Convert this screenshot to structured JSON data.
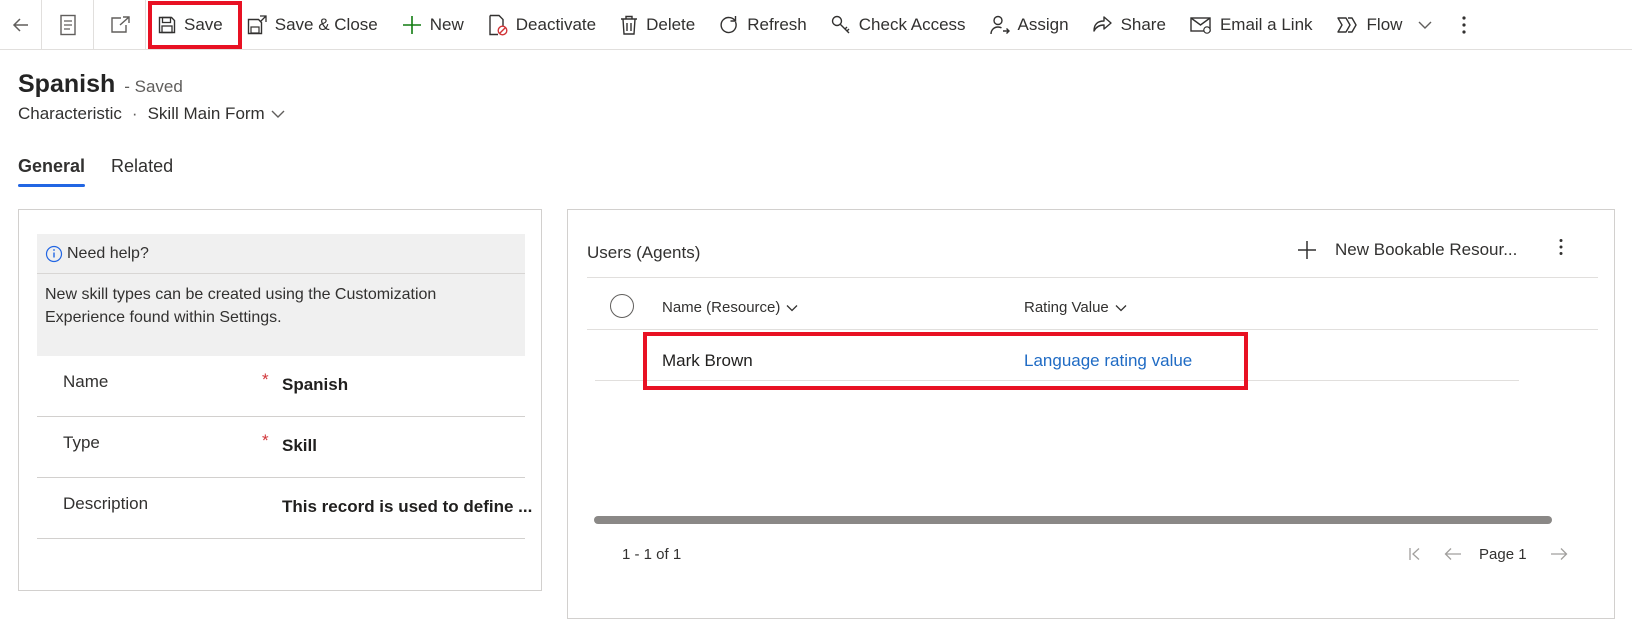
{
  "toolbar": {
    "save": "Save",
    "save_close": "Save & Close",
    "new": "New",
    "deactivate": "Deactivate",
    "delete": "Delete",
    "refresh": "Refresh",
    "check_access": "Check Access",
    "assign": "Assign",
    "share": "Share",
    "email_link": "Email a Link",
    "flow": "Flow"
  },
  "record": {
    "title": "Spanish",
    "status": "- Saved",
    "entity": "Characteristic",
    "separator": "·",
    "form": "Skill Main Form"
  },
  "tabs": [
    {
      "label": "General",
      "active": true
    },
    {
      "label": "Related",
      "active": false
    }
  ],
  "help": {
    "title": "Need help?",
    "body": "New skill types can be created using the Customization Experience found within Settings."
  },
  "fields": [
    {
      "label": "Name",
      "required": "*",
      "value": "Spanish"
    },
    {
      "label": "Type",
      "required": "*",
      "value": "Skill"
    },
    {
      "label": "Description",
      "required": "",
      "value": "This record is used to define ..."
    }
  ],
  "subgrid": {
    "title": "Users (Agents)",
    "new_label": "New Bookable Resour...",
    "columns": [
      "Name (Resource)",
      "Rating Value"
    ],
    "rows": [
      {
        "name": "Mark Brown",
        "rating": "Language rating value"
      }
    ],
    "count": "1 - 1 of 1",
    "page": "Page 1"
  },
  "colors": {
    "accent": "#2266e3",
    "highlight": "#e81123",
    "link": "#1f6bc4",
    "required": "#d13438"
  }
}
